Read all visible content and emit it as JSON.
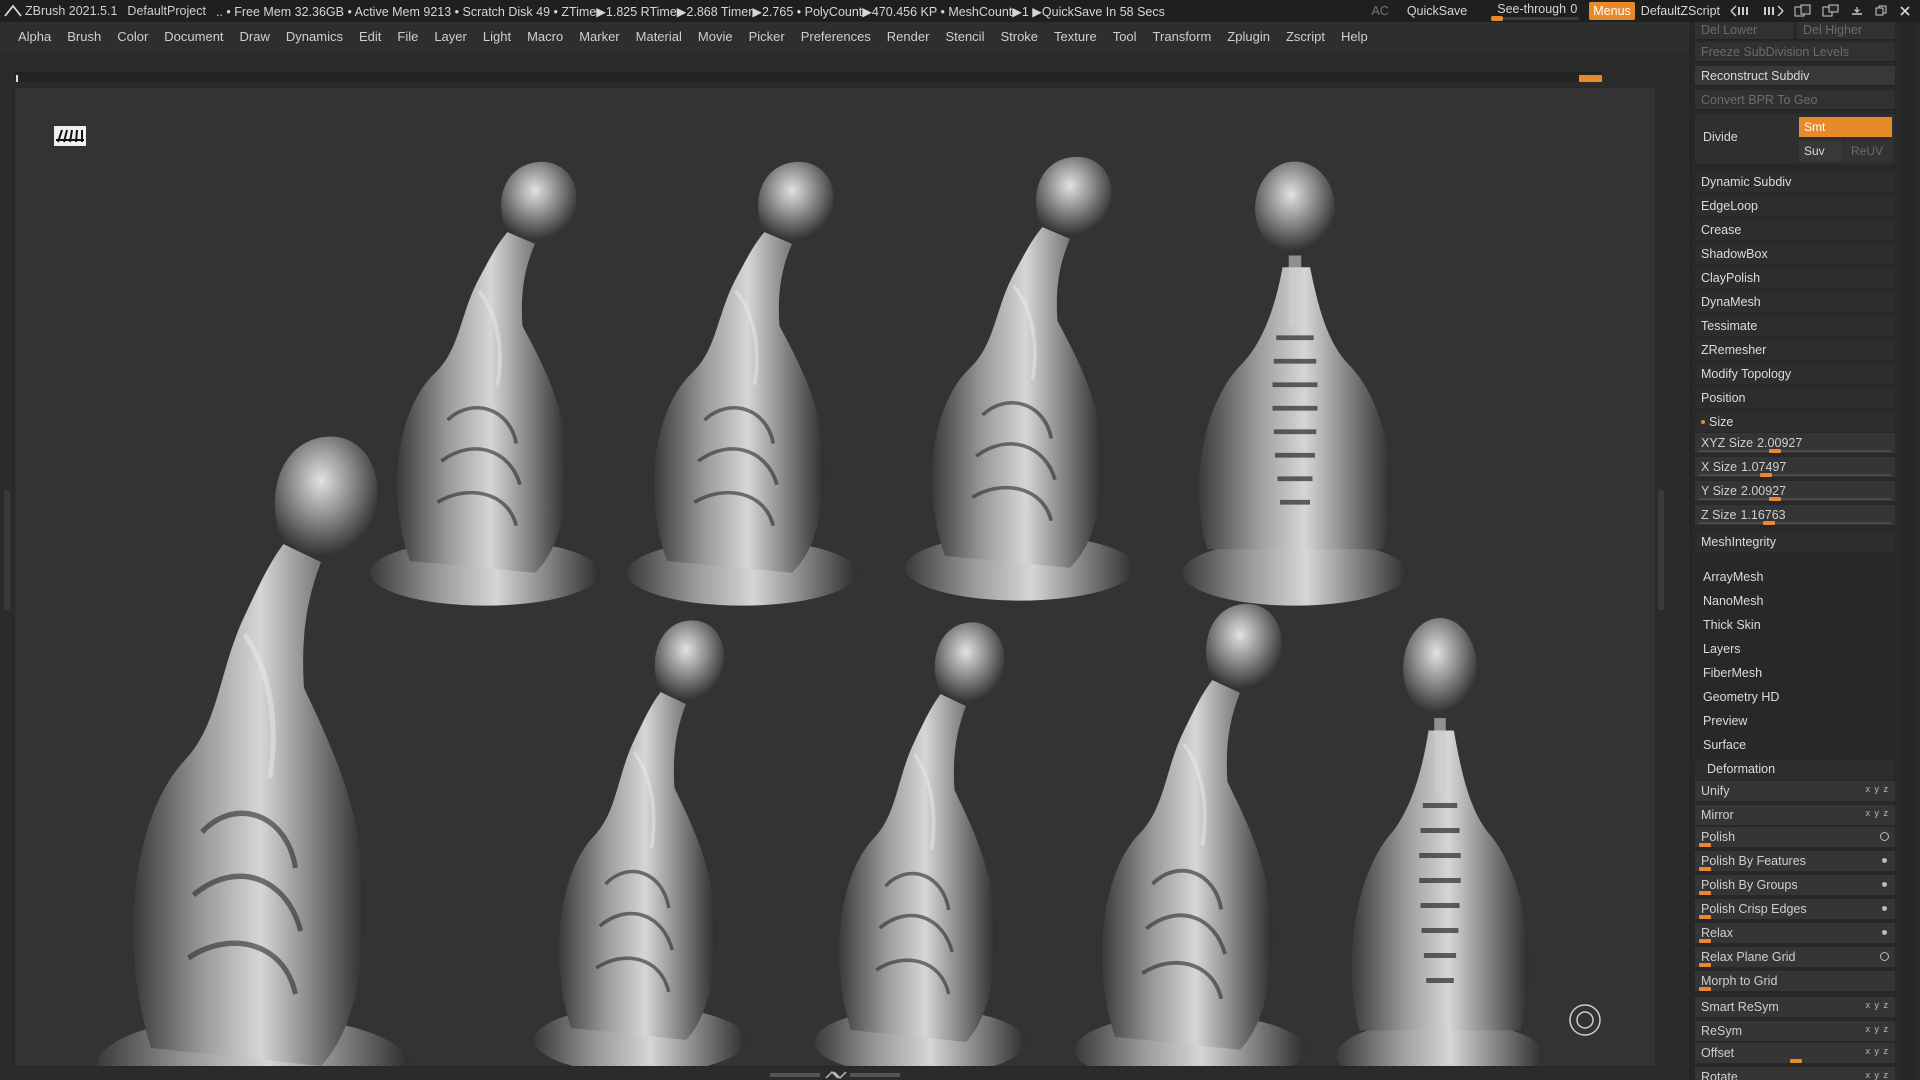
{
  "app": {
    "title": "ZBrush 2021.5.1",
    "project": "DefaultProject",
    "status_text": ".. • Free Mem 32.36GB • Active Mem 9213 • Scratch Disk 49 •  ZTime▶1.825 RTime▶2.868 Timer▶2.765 • PolyCount▶470.456 KP • MeshCount▶1  ▶QuickSave In 58 Secs",
    "ac_label": "AC",
    "quicksave_label": "QuickSave",
    "seethrough_label": "See-through",
    "seethrough_value": "0",
    "menus_label": "Menus",
    "zscript_label": "DefaultZScript"
  },
  "menubar": {
    "items": [
      "Alpha",
      "Brush",
      "Color",
      "Document",
      "Draw",
      "Dynamics",
      "Edit",
      "File",
      "Layer",
      "Light",
      "Macro",
      "Marker",
      "Material",
      "Movie",
      "Picker",
      "Preferences",
      "Render",
      "Stencil",
      "Stroke",
      "Texture",
      "Tool",
      "Transform",
      "Zplugin",
      "Zscript",
      "Help"
    ]
  },
  "palette": {
    "del_lower": "Del Lower",
    "del_higher": "Del Higher",
    "freeze_subdiv": "Freeze SubDivision Levels",
    "reconstruct_subdiv": "Reconstruct Subdiv",
    "convert_bpr": "Convert BPR To Geo",
    "divide": "Divide",
    "smt": "Smt",
    "suv": "Suv",
    "reuv": "ReUV",
    "geometry_items": [
      "Dynamic Subdiv",
      "EdgeLoop",
      "Crease",
      "ShadowBox",
      "ClayPolish",
      "DynaMesh",
      "Tessimate",
      "ZRemesher",
      "Modify Topology",
      "Position"
    ],
    "size_label": "Size",
    "sliders": [
      {
        "label": "XYZ Size",
        "value": "2.00927",
        "level": 0.4
      },
      {
        "label": "X Size",
        "value": "1.07497",
        "level": 0.35
      },
      {
        "label": "Y Size",
        "value": "2.00927",
        "level": 0.4
      },
      {
        "label": "Z Size",
        "value": "1.16763",
        "level": 0.37
      }
    ],
    "mesh_integrity": "MeshIntegrity",
    "subpalettes": [
      "ArrayMesh",
      "NanoMesh",
      "Thick Skin",
      "Layers",
      "FiberMesh",
      "Geometry HD",
      "Preview",
      "Surface"
    ],
    "deformation": "Deformation",
    "deform_items": [
      {
        "label": "Unify",
        "ind": "icons"
      },
      {
        "label": "Mirror",
        "ind": "icons"
      },
      {
        "label": "Polish",
        "ind": "circle"
      },
      {
        "label": "Polish By Features",
        "ind": "dot"
      },
      {
        "label": "Polish By Groups",
        "ind": "dot"
      },
      {
        "label": "Polish Crisp Edges",
        "ind": "dot"
      },
      {
        "label": "Relax",
        "ind": "dot"
      },
      {
        "label": "Relax Plane Grid",
        "ind": "circle"
      },
      {
        "label": "Morph to Grid",
        "ind": "none"
      },
      {
        "label": "Smart ReSym",
        "ind": "icons"
      },
      {
        "label": "ReSym",
        "ind": "icons"
      },
      {
        "label": "Offset",
        "ind": "icons"
      },
      {
        "label": "Rotate",
        "ind": "icons"
      }
    ]
  },
  "colors": {
    "accent": "#e8892a",
    "background": "#333333",
    "panel": "#282828"
  }
}
